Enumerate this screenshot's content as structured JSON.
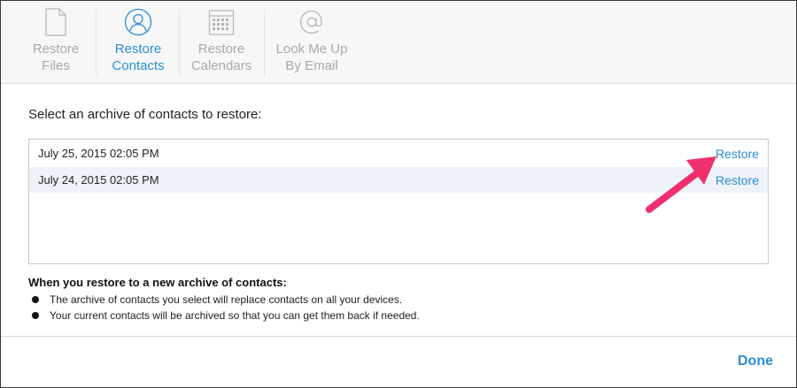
{
  "toolbar": {
    "tabs": [
      {
        "label_line1": "Restore",
        "label_line2": "Files",
        "icon": "document-icon"
      },
      {
        "label_line1": "Restore",
        "label_line2": "Contacts",
        "icon": "person-icon"
      },
      {
        "label_line1": "Restore",
        "label_line2": "Calendars",
        "icon": "calendar-icon"
      },
      {
        "label_line1": "Look Me Up",
        "label_line2": "By Email",
        "icon": "at-sign-icon"
      }
    ],
    "active_tab": "Restore Contacts"
  },
  "content": {
    "prompt": "Select an archive of contacts to restore:",
    "archives": [
      {
        "date": "July 25, 2015 02:05 PM",
        "action": "Restore"
      },
      {
        "date": "July 24, 2015 02:05 PM",
        "action": "Restore"
      }
    ],
    "info_title": "When you restore to a new archive of contacts:",
    "bullets": [
      "The archive of contacts you select will replace contacts on all your devices.",
      "Your current contacts will be archived so that you can get them back if needed."
    ]
  },
  "footer": {
    "done_label": "Done"
  },
  "colors": {
    "accent": "#2c8ed6",
    "inactive": "#a8a8a8",
    "annotation_arrow": "#f0306e",
    "selected_row": "#eef3fa"
  }
}
